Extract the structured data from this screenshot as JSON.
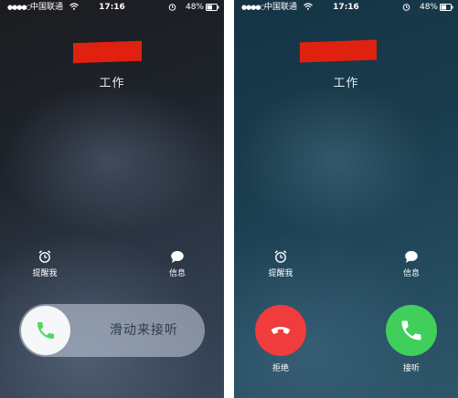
{
  "status_bar": {
    "signal": "●●●●○",
    "carrier": "中国联通",
    "time": "17:16",
    "battery": "48%"
  },
  "left_screen": {
    "caller_name": "",
    "caller_label": "工作",
    "remind_me": "提醒我",
    "message": "信息",
    "slide_text": "滑动来接听"
  },
  "right_screen": {
    "caller_name": "",
    "caller_label": "工作",
    "remind_me": "提醒我",
    "message": "信息",
    "decline": "拒绝",
    "accept": "接听"
  },
  "colors": {
    "decline": "#f03c3c",
    "accept": "#3fcf5a",
    "redaction": "#e1210f",
    "slider_phone": "#4cd964"
  },
  "icons": [
    "signal-dots",
    "wifi-icon",
    "alarm-icon",
    "battery-icon",
    "message-bubble-icon",
    "phone-handset-icon",
    "phone-hangup-icon"
  ]
}
